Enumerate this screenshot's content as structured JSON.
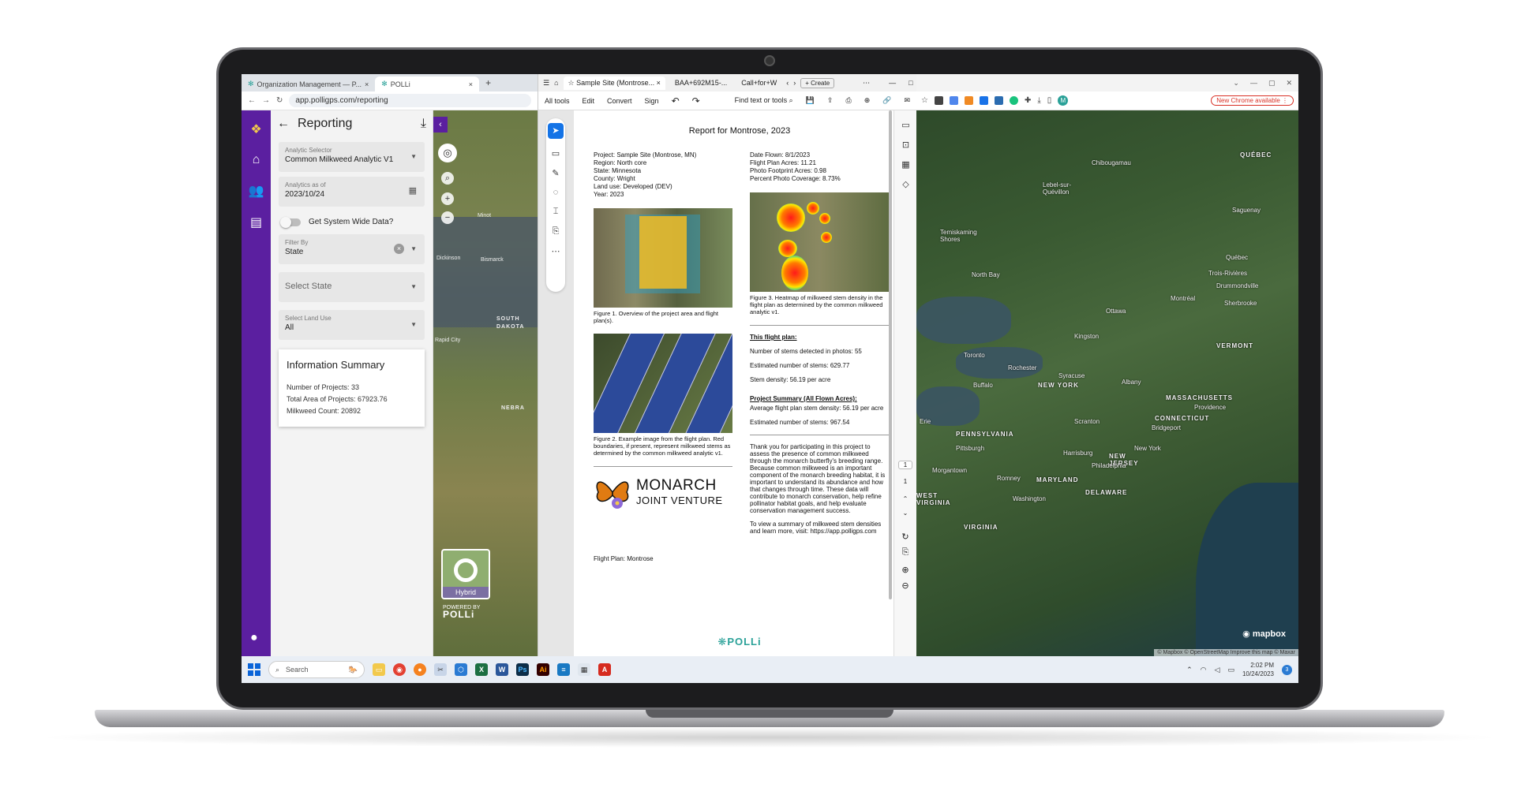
{
  "left_browser": {
    "tabs": [
      {
        "label": "Organization Management — P..."
      },
      {
        "label": "POLLi"
      }
    ],
    "url": "app.polligps.com/reporting"
  },
  "reporting": {
    "title": "Reporting",
    "analytic_selector": {
      "label": "Analytic Selector",
      "value": "Common Milkweed Analytic V1"
    },
    "analytics_as_of": {
      "label": "Analytics as of",
      "value": "2023/10/24"
    },
    "system_wide_label": "Get System Wide Data?",
    "filter_by": {
      "label": "Filter By",
      "value": "State"
    },
    "select_state": {
      "placeholder": "Select State"
    },
    "land_use": {
      "label": "Select Land Use",
      "value": "All"
    },
    "summary": {
      "title": "Information Summary",
      "projects": "Number of Projects: 33",
      "area": "Total Area of Projects: 67923.76",
      "milkweed": "Milkweed Count: 20892"
    }
  },
  "left_map": {
    "labels": [
      "SOUTH DAKOTA",
      "NEBRA",
      "Rapid City",
      "Bismarck",
      "Minot",
      "Dickinson"
    ],
    "layer_toggle": "Hybrid",
    "powered_by": "POWERED BY",
    "brand": "POLLi"
  },
  "acrobat": {
    "tabs": [
      {
        "label": "Sample Site (Montrose..."
      },
      {
        "label": "BAA+692M15-..."
      },
      {
        "label": "Call+for+W"
      }
    ],
    "create": "Create",
    "menu": [
      "All tools",
      "Edit",
      "Convert",
      "Sign"
    ],
    "find": "Find text or tools",
    "page_current": "1",
    "page_total": "1"
  },
  "report": {
    "title": "Report for Montrose, 2023",
    "meta_left": [
      "Project: Sample Site (Montrose, MN)",
      "Region: North core",
      "State: Minnesota",
      "County: Wright",
      "Land use: Developed (DEV)",
      "Year: 2023"
    ],
    "meta_right": [
      "Date Flown: 8/1/2023",
      "Flight Plan Acres: 11.21",
      "Photo Footprint Acres: 0.98",
      "Percent Photo Coverage: 8.73%"
    ],
    "fig1_caption": "Figure 1. Overview of the project area and flight plan(s).",
    "fig2_caption": "Figure 2. Example image from the flight plan. Red boundaries, if present, represent milkweed stems as determined by the common milkweed analytic v1.",
    "fig3_caption": "Figure 3. Heatmap of milkweed stem density in the flight plan as determined by the common milkweed analytic v1.",
    "this_flight_heading": "This flight plan:",
    "stems_detected": "Number of stems detected in photos: 55",
    "estimated_stems": "Estimated number of stems: 629.77",
    "stem_density": "Stem density: 56.19 per acre",
    "project_summary_heading": "Project Summary (All Flown Acres):",
    "avg_density": "Average flight plan stem density: 56.19 per acre",
    "estimated_total": "Estimated number of stems: 967.54",
    "thanks": "Thank you for participating in this project to assess the presence of common milkweed through the monarch butterfly's breeding range. Because common milkweed is an important component of the monarch breeding habitat, it is important to understand its abundance and how that changes through time. These data will contribute to monarch conservation, help refine pollinator habitat goals, and help evaluate conservation management success.",
    "visit": "To view a summary of milkweed stem densities and learn more, visit: https://app.polligps.com",
    "logo_line1": "MONARCH",
    "logo_line2": "JOINT VENTURE",
    "flight_plan": "Flight Plan: Montrose",
    "footer_brand": "POLLi"
  },
  "right_browser": {
    "new_chrome": "New Chrome available",
    "profile": "M"
  },
  "right_map": {
    "labels": {
      "quebec": "QUÉBEC",
      "chibougamau": "Chibougamau",
      "lebel": "Lebel-sur-Quévillon",
      "saguenay": "Saguenay",
      "temiskaming": "Temiskaming Shores",
      "quebec_city": "Québec",
      "trois": "Trois-Rivières",
      "drummond": "Drummondville",
      "north_bay": "North Bay",
      "montreal": "Montréal",
      "sherbrooke": "Sherbrooke",
      "ottawa": "Ottawa",
      "vermont": "VERMONT",
      "kingston": "Kingston",
      "toronto": "Toronto",
      "rochester": "Rochester",
      "buffalo": "Buffalo",
      "syracuse": "Syracuse",
      "albany": "Albany",
      "new_york_state": "NEW YORK",
      "massachusetts": "MASSACHUSETTS",
      "providence": "Providence",
      "connecticut": "CONNECTICUT",
      "bridgeport": "Bridgeport",
      "scranton": "Scranton",
      "pennsylvania": "PENNSYLVANIA",
      "pittsburgh": "Pittsburgh",
      "harrisburg": "Harrisburg",
      "new_jersey": "NEW JERSEY",
      "new_york_city": "New York",
      "philadelphia": "Philadelphia",
      "morgantown": "Morgantown",
      "maryland": "MARYLAND",
      "delaware": "DELAWARE",
      "washington": "Washington",
      "west_virginia": "WEST VIRGINIA",
      "virginia": "VIRGINIA",
      "romney": "Romney",
      "erie": "Erie"
    },
    "brand": "mapbox",
    "attribution": "© Mapbox © OpenStreetMap Improve this map © Maxar"
  },
  "taskbar": {
    "search": "Search",
    "time": "2:02 PM",
    "date": "10/24/2023",
    "notifications": "3"
  }
}
